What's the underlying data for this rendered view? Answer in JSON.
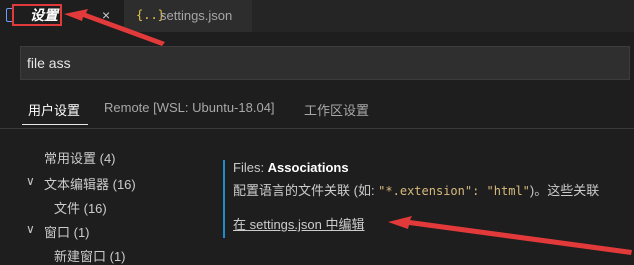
{
  "tabs": [
    {
      "label": "设置",
      "icon": "settings-file-icon",
      "close_glyph": "×"
    },
    {
      "label": "settings.json",
      "icon_glyph": "{..}"
    }
  ],
  "search": {
    "value": "file ass"
  },
  "scopes": [
    "用户设置",
    "Remote [WSL: Ubuntu-18.04]",
    "工作区设置"
  ],
  "toc": {
    "items": [
      {
        "label": "常用设置 (4)",
        "level": 0,
        "expandable": false
      },
      {
        "label": "文本编辑器 (16)",
        "level": 0,
        "expandable": true
      },
      {
        "label": "文件 (16)",
        "level": 1,
        "expandable": false
      },
      {
        "label": "窗口 (1)",
        "level": 0,
        "expandable": true
      },
      {
        "label": "新建窗口 (1)",
        "level": 1,
        "expandable": false
      }
    ],
    "chevron_glyph": "∨"
  },
  "setting": {
    "category": "Files: ",
    "name": "Associations",
    "desc_prefix": "配置语言的文件关联 (如: ",
    "desc_code": "\"*.extension\": \"html\"",
    "desc_suffix": ")。这些关联",
    "edit_link": "在 settings.json 中编辑"
  },
  "colors": {
    "annotation": "#e23a3a",
    "accent": "#1f8ad2"
  }
}
